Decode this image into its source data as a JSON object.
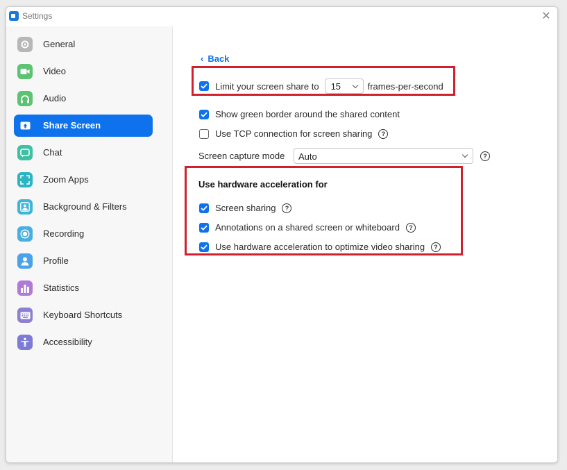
{
  "window": {
    "title": "Settings",
    "close_glyph": "✕"
  },
  "sidebar": {
    "items": [
      {
        "label": "General",
        "icon": "gear-icon",
        "color": "#b7b7b7"
      },
      {
        "label": "Video",
        "icon": "video-camera-icon",
        "color": "#5cc372"
      },
      {
        "label": "Audio",
        "icon": "headphones-icon",
        "color": "#5cc372"
      },
      {
        "label": "Share Screen",
        "icon": "share-screen-icon",
        "color": "#0e72ed",
        "active": true
      },
      {
        "label": "Chat",
        "icon": "chat-bubble-icon",
        "color": "#3ec0a3"
      },
      {
        "label": "Zoom Apps",
        "icon": "zoom-apps-icon",
        "color": "#2bb5c4"
      },
      {
        "label": "Background & Filters",
        "icon": "background-person-icon",
        "color": "#3fb6d8"
      },
      {
        "label": "Recording",
        "icon": "record-icon",
        "color": "#4aaedf"
      },
      {
        "label": "Profile",
        "icon": "profile-person-icon",
        "color": "#4aa3e8"
      },
      {
        "label": "Statistics",
        "icon": "bar-chart-icon",
        "color": "#b07bd6"
      },
      {
        "label": "Keyboard Shortcuts",
        "icon": "keyboard-icon",
        "color": "#8e7fd1"
      },
      {
        "label": "Accessibility",
        "icon": "accessibility-icon",
        "color": "#7d7bd6"
      }
    ]
  },
  "main": {
    "back_label": "Back",
    "limit_fps": {
      "checked": true,
      "label_before": "Limit your screen share to",
      "value": "15",
      "label_after": "frames-per-second"
    },
    "green_border": {
      "checked": true,
      "label": "Show green border around the shared content"
    },
    "tcp": {
      "checked": false,
      "label": "Use TCP connection for screen sharing"
    },
    "capture_mode": {
      "label": "Screen capture mode",
      "value": "Auto"
    },
    "hw_accel": {
      "heading": "Use hardware acceleration for",
      "items": [
        {
          "checked": true,
          "label": "Screen sharing"
        },
        {
          "checked": true,
          "label": "Annotations on a shared screen or whiteboard"
        },
        {
          "checked": true,
          "label": "Use hardware acceleration to optimize video sharing"
        }
      ]
    },
    "help_glyph": "?"
  },
  "colors": {
    "accent": "#0e72ed",
    "highlight_box": "#d0202e"
  }
}
